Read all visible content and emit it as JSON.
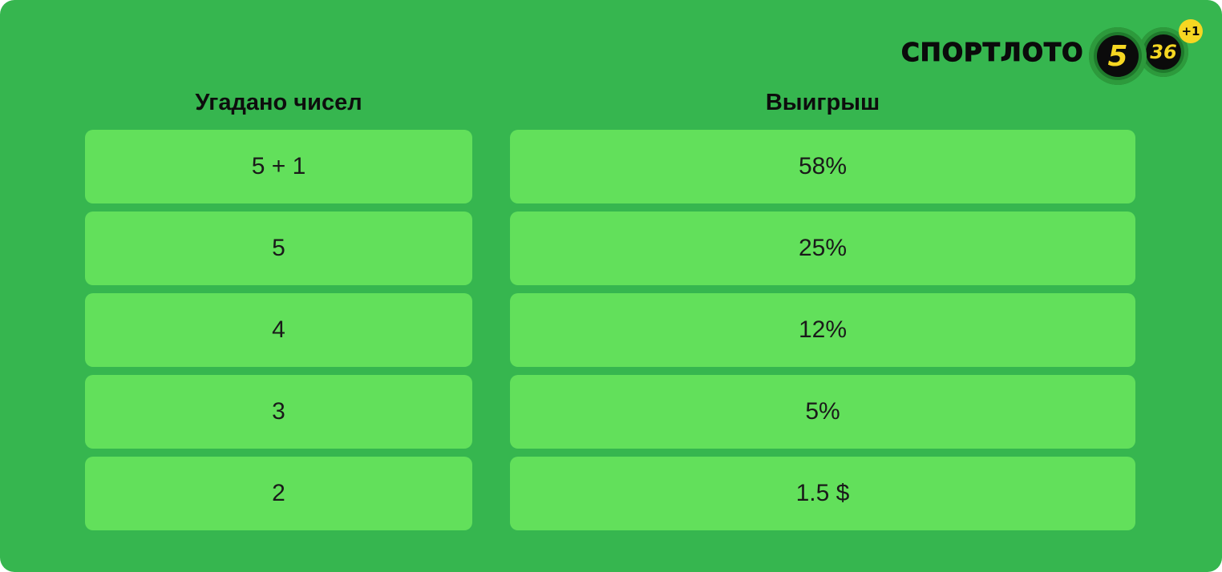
{
  "logo": {
    "brand_text": "СПОРТЛОТО",
    "ball_main": "5",
    "ball_secondary": "36",
    "badge": "+1"
  },
  "table": {
    "headers": {
      "matched": "Угадано чисел",
      "prize": "Выигрыш"
    },
    "rows": [
      {
        "matched": "5 + 1",
        "prize": "58%"
      },
      {
        "matched": "5",
        "prize": "25%"
      },
      {
        "matched": "4",
        "prize": "12%"
      },
      {
        "matched": "3",
        "prize": "5%"
      },
      {
        "matched": "2",
        "prize": "1.5 $"
      }
    ]
  },
  "colors": {
    "background": "#36b64f",
    "cell": "#62e05b",
    "ball_number": "#f6d722",
    "text": "#0d0d0d"
  }
}
